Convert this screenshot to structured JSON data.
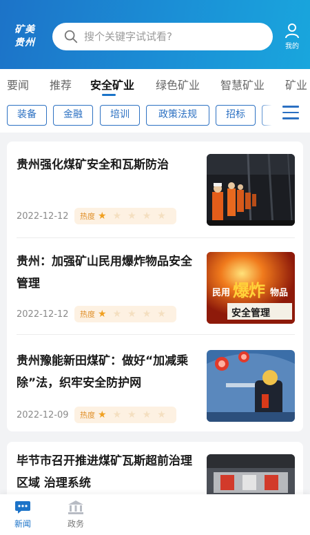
{
  "header": {
    "logo_line1": "矿美",
    "logo_line2": "贵州",
    "search_placeholder": "搜个关键字试试看?",
    "user_label": "我的"
  },
  "tabs": [
    {
      "label": "要闻"
    },
    {
      "label": "推荐"
    },
    {
      "label": "安全矿业",
      "active": true
    },
    {
      "label": "绿色矿业"
    },
    {
      "label": "智慧矿业"
    },
    {
      "label": "矿业"
    }
  ],
  "chips": [
    {
      "label": "装备"
    },
    {
      "label": "金融"
    },
    {
      "label": "培训"
    },
    {
      "label": "政策法规"
    },
    {
      "label": "招标"
    },
    {
      "label": "曝"
    }
  ],
  "articles": [
    {
      "title": "贵州强化煤矿安全和瓦斯防治",
      "date": "2022-12-12",
      "heat_label": "热度",
      "rating": 1,
      "thumb_icon": "miners-underground-image"
    },
    {
      "title": "贵州：加强矿山民用爆炸物品安全管理",
      "date": "2022-12-12",
      "heat_label": "热度",
      "rating": 1,
      "thumb_icon": "explosives-safety-poster-image",
      "thumb_text_1": "民用",
      "thumb_text_2": "爆炸",
      "thumb_text_3": "物品",
      "thumb_text_4": "安全管理"
    },
    {
      "title": "贵州豫能新田煤矿：做好“加减乘除”法，织牢安全防护网",
      "date": "2022-12-09",
      "heat_label": "热度",
      "rating": 1,
      "thumb_icon": "tunnel-worker-image"
    },
    {
      "title": "毕节市召开推进煤矿瓦斯超前治理区域 治理系统",
      "thumb_icon": "meeting-room-image"
    }
  ],
  "bottom_nav": [
    {
      "label": "新闻",
      "active": true,
      "icon": "chat-icon"
    },
    {
      "label": "政务",
      "icon": "government-building-icon"
    }
  ],
  "colors": {
    "brand": "#1c73c8",
    "chip": "#2b70c2",
    "heat": "#f0a020"
  }
}
